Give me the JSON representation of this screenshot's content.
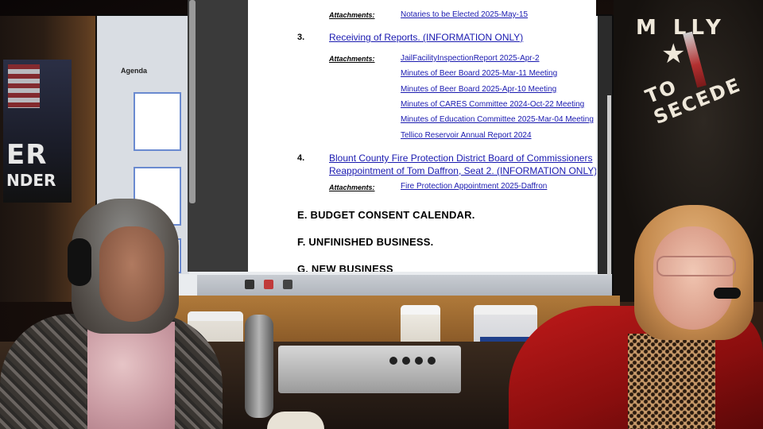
{
  "document": {
    "attachments_label": "Attachments:",
    "top_attachment": "Notaries to be Elected 2025-May-15",
    "item3": {
      "number": "3.",
      "title": "Receiving of Reports. (INFORMATION ONLY)",
      "attachments": [
        "JailFacilityInspectionReport 2025-Apr-2",
        "Minutes of Beer Board 2025-Mar-11 Meeting",
        "Minutes of Beer Board 2025-Apr-10 Meeting",
        "Minutes of CARES Committee 2024-Oct-22 Meeting",
        "Minutes of Education Committee 2025-Mar-04 Meeting",
        "Tellico Reservoir Annual Report 2024"
      ]
    },
    "item4": {
      "number": "4.",
      "title_line1": "Blount County Fire Protection District Board of Commissioners",
      "title_line2": "Reappointment of Tom Daffron, Seat 2. (INFORMATION ONLY)",
      "attachments": [
        "Fire Protection Appointment 2025-Daffron"
      ]
    },
    "sections": [
      "E.  BUDGET CONSENT CALENDAR.",
      "F.  UNFINISHED BUSINESS.",
      "G.  NEW BUSINESS"
    ]
  },
  "tv_app": {
    "agenda_label": "Agenda"
  },
  "background": {
    "poster_text_big": "ER",
    "poster_text_small": "NDER",
    "sign_text": "TO SECEDE",
    "sign_top_text": "M     LLY"
  },
  "colors": {
    "link": "#1a1ab0",
    "jacket": "#c01a1a"
  }
}
